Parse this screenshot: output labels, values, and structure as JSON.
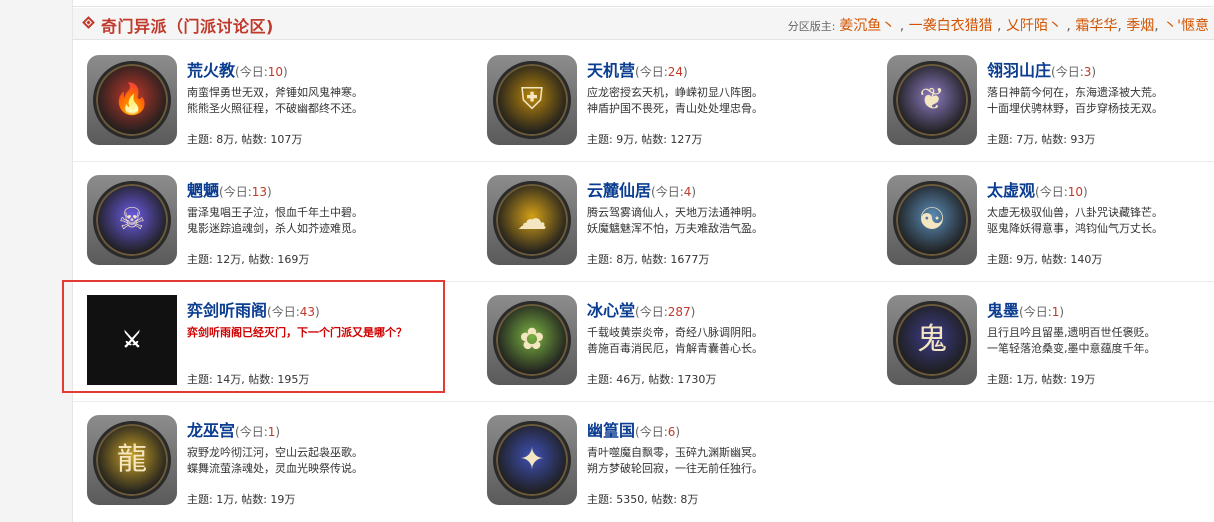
{
  "header": {
    "title": "奇门异派（门派讨论区)",
    "moderators_label": "分区版主:",
    "moderators": [
      "姜沉鱼丶",
      "一袭白衣猎猎",
      "乂阡陌丶",
      "霜华华",
      "季烟",
      "丶'惬意"
    ]
  },
  "today_label": "(今日:",
  "today_suffix": ")",
  "forums": [
    {
      "name": "荒火教",
      "today": "10",
      "desc1": "南蛮悍勇世无双，斧锤如风鬼神寒。",
      "desc2": "熊熊圣火照征程，不破幽都终不还。",
      "stats": "主题: 8万, 帖数: 107万",
      "icon": "flame-emblem-icon",
      "color": "#c0392b"
    },
    {
      "name": "天机营",
      "today": "24",
      "desc1": "应龙密授玄天机，峥嵘初显八阵图。",
      "desc2": "神盾护国不畏死，青山处处埋忠骨。",
      "stats": "主题: 9万, 帖数: 127万",
      "icon": "shield-emblem-icon",
      "color": "#b8860b"
    },
    {
      "name": "翎羽山庄",
      "today": "3",
      "desc1": "落日神箭今何在，东海遗泽被大荒。",
      "desc2": "十面埋伏骋林野，百步穿杨技无双。",
      "stats": "主题: 7万, 帖数: 93万",
      "icon": "wings-emblem-icon",
      "color": "#8e7cc3"
    },
    {
      "name": "魍魉",
      "today": "13",
      "desc1": "雷泽鬼唱王子泣，恨血千年土中碧。",
      "desc2": "鬼影迷踪追魂剑，杀人如芥迹难觅。",
      "stats": "主题: 12万, 帖数: 169万",
      "icon": "skull-emblem-icon",
      "color": "#6c5ce7"
    },
    {
      "name": "云麓仙居",
      "today": "4",
      "desc1": "腾云驾雾谪仙人，天地万法通神明。",
      "desc2": "妖魔魑魅浑不怕，万夫难敌浩气盈。",
      "stats": "主题: 8万, 帖数: 1677万",
      "icon": "cloud-emblem-icon",
      "color": "#d4a017"
    },
    {
      "name": "太虚观",
      "today": "10",
      "desc1": "太虚无极驭仙兽，八卦咒诀藏锋芒。",
      "desc2": "驱鬼降妖得意事，鸿钧仙气万丈长。",
      "stats": "主题: 9万, 帖数: 140万",
      "icon": "taiji-emblem-icon",
      "color": "#5b8db8"
    },
    {
      "name": "弈剑听雨阁",
      "today": "43",
      "desc1": "弈剑听雨阁已经灭门，下一个门派又是哪个？",
      "desc2": "",
      "stats": "主题: 14万, 帖数: 195万",
      "icon": "ink-sword-emblem-icon",
      "color": "#111111",
      "hot": true
    },
    {
      "name": "冰心堂",
      "today": "287",
      "desc1": "千载岐黄崇炎帝，奇经八脉调阴阳。",
      "desc2": "善施百毒消民厄，肯解青囊善心长。",
      "stats": "主题: 46万, 帖数: 1730万",
      "icon": "lotus-emblem-icon",
      "color": "#7cb342"
    },
    {
      "name": "鬼墨",
      "today": "1",
      "desc1": "且行且吟且留墨,遗明百世任褒贬。",
      "desc2": "一笔轻落沧桑变,墨中意蕴度千年。",
      "stats": "主题: 1万, 帖数: 19万",
      "icon": "ghost-ink-emblem-icon",
      "color": "#3d3d8a"
    },
    {
      "name": "龙巫宫",
      "today": "1",
      "desc1": "寂野龙吟彻江河，空山云起袅巫歌。",
      "desc2": "蝶舞流萤涤魂处，灵血光映祭传说。",
      "stats": "主题: 1万, 帖数: 19万",
      "icon": "dragon-emblem-icon",
      "color": "#c9a227"
    },
    {
      "name": "幽篁国",
      "today": "6",
      "desc1": "青叶噬魔自飘零，玉碎九渊斯幽冥。",
      "desc2": "朔方梦破轮回寂，一往无前任独行。",
      "stats": "主题: 5350, 帖数: 8万",
      "icon": "star-emblem-icon",
      "color": "#3f51b5"
    }
  ]
}
